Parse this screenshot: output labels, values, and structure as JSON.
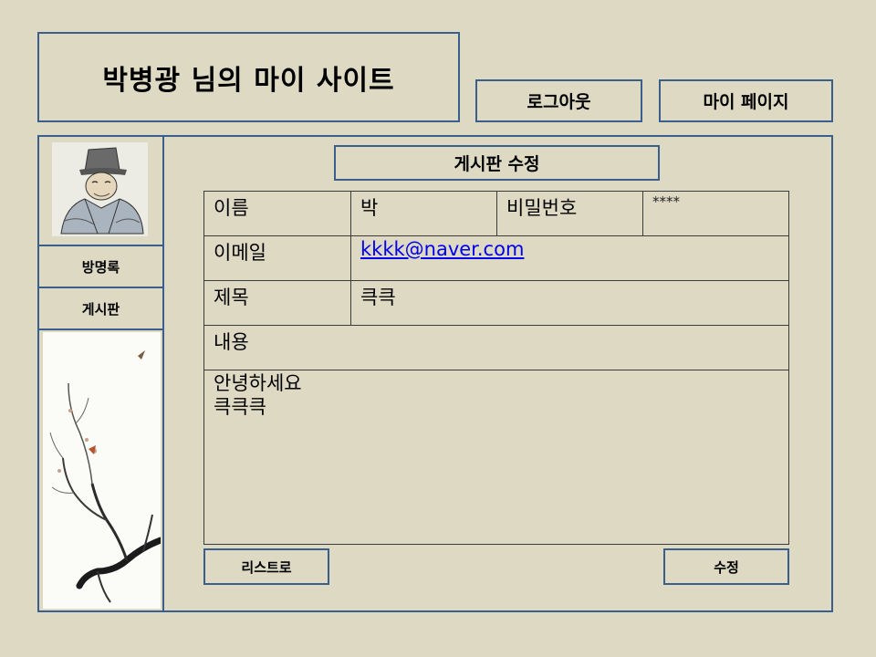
{
  "header": {
    "site_title": "박병광 님의 마이 사이트",
    "logout_label": "로그아웃",
    "mypage_label": "마이 페이지"
  },
  "sidebar": {
    "guestbook_label": "방명록",
    "board_label": "게시판"
  },
  "board": {
    "heading": "게시판 수정",
    "form": {
      "name_label": "이름",
      "name_value": "박",
      "password_label": "비밀번호",
      "password_value": "****",
      "email_label": "이메일",
      "email_value": "kkkk@naver.com",
      "subject_label": "제목",
      "subject_value": "큭큭",
      "content_label": "내용",
      "content_value": "안녕하세요\n큭큭큭"
    },
    "list_button_label": "리스트로",
    "edit_button_label": "수정"
  },
  "colors": {
    "background": "#ddd9c3",
    "border": "#3a5f8c",
    "link": "#0000ee"
  }
}
